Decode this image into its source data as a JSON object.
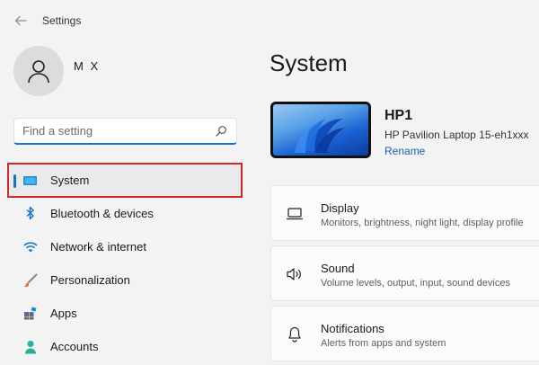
{
  "window": {
    "title": "Settings"
  },
  "user": {
    "name": "M X"
  },
  "search": {
    "placeholder": "Find a setting"
  },
  "sidebar": {
    "items": [
      {
        "label": "System",
        "icon": "monitor-icon"
      },
      {
        "label": "Bluetooth & devices",
        "icon": "bluetooth-icon"
      },
      {
        "label": "Network & internet",
        "icon": "wifi-icon"
      },
      {
        "label": "Personalization",
        "icon": "brush-icon"
      },
      {
        "label": "Apps",
        "icon": "apps-icon"
      },
      {
        "label": "Accounts",
        "icon": "person-icon"
      }
    ],
    "selected": "System"
  },
  "main": {
    "title": "System",
    "device": {
      "name": "HP1",
      "model": "HP Pavilion Laptop 15-eh1xxx",
      "rename_label": "Rename"
    },
    "cards": [
      {
        "title": "Display",
        "subtitle": "Monitors, brightness, night light, display profile",
        "icon": "display-icon"
      },
      {
        "title": "Sound",
        "subtitle": "Volume levels, output, input, sound devices",
        "icon": "speaker-icon"
      },
      {
        "title": "Notifications",
        "subtitle": "Alerts from apps and system",
        "icon": "bell-icon"
      }
    ]
  },
  "colors": {
    "accent": "#1a73c7",
    "highlight_border": "#d02828",
    "link": "#1a5fb4"
  }
}
